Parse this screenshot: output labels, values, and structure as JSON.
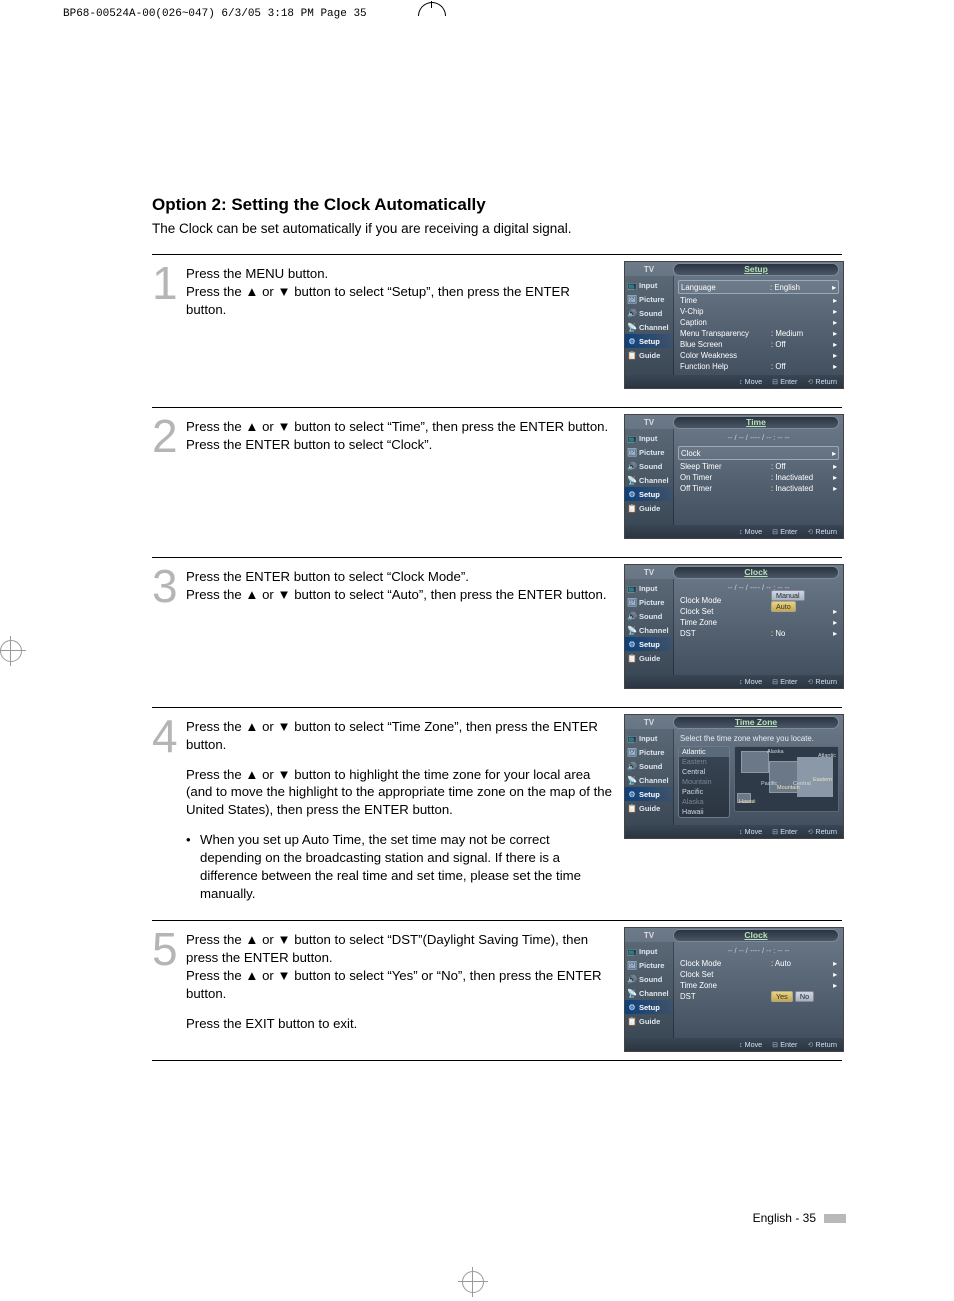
{
  "plate_line": "BP68-00524A-00(026~047)  6/3/05  3:18 PM  Page 35",
  "page_footer": {
    "text": "English - 35"
  },
  "heading": "Option 2: Setting the Clock Automatically",
  "intro": "The Clock can be set automatically if you are receiving a digital signal.",
  "arrows": {
    "up": "▲",
    "down": "▼"
  },
  "steps": {
    "s1": {
      "num": "1",
      "l1": "Press the MENU button.",
      "l2a": "Press the ",
      "l2b": " or ",
      "l2c": " button to select “Setup”, then press the ENTER button."
    },
    "s2": {
      "num": "2",
      "l1a": "Press the ",
      "l1b": " or ",
      "l1c": " button to select “Time”, then press the ENTER button.",
      "l2": "Press the ENTER button to select “Clock”."
    },
    "s3": {
      "num": "3",
      "l1": "Press the ENTER button to select “Clock Mode”.",
      "l2a": "Press the ",
      "l2b": " or ",
      "l2c": " button to select “Auto”, then press the ENTER button."
    },
    "s4": {
      "num": "4",
      "l1a": "Press the ",
      "l1b": " or ",
      "l1c": " button to select “Time Zone”, then press the ENTER button.",
      "l2a": "Press the ",
      "l2b": " or ",
      "l2c": " button to highlight the time zone for your local area (and to move the highlight to the appropriate time zone on the map of the United States), then press the ENTER button.",
      "bullet": "When you set up Auto Time, the set time may not be correct depending on the broadcasting station and signal. If there is a difference between the real time and set time, please set the time manually."
    },
    "s5": {
      "num": "5",
      "l1a": "Press the ",
      "l1b": " or ",
      "l1c": " button to select “DST”(Daylight Saving Time), then press the ENTER button.",
      "l2a": "Press the ",
      "l2b": " or ",
      "l2c": " button to select “Yes” or “No”, then press the ENTER button.",
      "l3": "Press the EXIT button to exit."
    }
  },
  "osd_common": {
    "tv": "TV",
    "side": [
      "Input",
      "Picture",
      "Sound",
      "Channel",
      "Setup",
      "Guide"
    ],
    "foot": {
      "move": "Move",
      "enter": "Enter",
      "return": "Return"
    },
    "date_placeholder": "-- / -- / ---- / --  :  --  --"
  },
  "osd1": {
    "title": "Setup",
    "rows": [
      {
        "k": "Language",
        "v": ": English",
        "sel": true
      },
      {
        "k": "Time",
        "v": ""
      },
      {
        "k": "V-Chip",
        "v": ""
      },
      {
        "k": "Caption",
        "v": ""
      },
      {
        "k": "Menu Transparency",
        "v": ": Medium"
      },
      {
        "k": "Blue Screen",
        "v": ": Off"
      },
      {
        "k": "Color Weakness",
        "v": ""
      },
      {
        "k": "Function Help",
        "v": ": Off"
      }
    ],
    "sel_side": 4
  },
  "osd2": {
    "title": "Time",
    "rows": [
      {
        "k": "Clock",
        "v": "",
        "sel": true
      },
      {
        "k": "Sleep Timer",
        "v": ": Off"
      },
      {
        "k": "On Timer",
        "v": ": Inactivated"
      },
      {
        "k": "Off Timer",
        "v": ": Inactivated"
      }
    ],
    "sel_side": 4
  },
  "osd3": {
    "title": "Clock",
    "rows": [
      {
        "k": "Clock Mode",
        "opts": [
          "Manual",
          "Auto"
        ],
        "sel_opt": 1
      },
      {
        "k": "Clock Set",
        "v": ""
      },
      {
        "k": "Time Zone",
        "v": ""
      },
      {
        "k": "DST",
        "v": ": No"
      }
    ],
    "sel_side": 4
  },
  "osd4": {
    "title": "Time Zone",
    "prompt": "Select the time zone where you locate.",
    "zones": [
      "Atlantic",
      "Eastern",
      "Central",
      "Mountain",
      "Pacific",
      "Alaska",
      "Hawaii"
    ],
    "map_labels": [
      "Alaska",
      "Atlantic",
      "Pacific",
      "Mountain",
      "Central",
      "Eastern",
      "Hawaii"
    ],
    "sel_side": 4
  },
  "osd5": {
    "title": "Clock",
    "rows": [
      {
        "k": "Clock Mode",
        "v": ": Auto"
      },
      {
        "k": "Clock Set",
        "v": ""
      },
      {
        "k": "Time Zone",
        "v": ""
      },
      {
        "k": "DST",
        "opts": [
          "Yes",
          "No"
        ],
        "sel_opt": 0
      }
    ],
    "sel_side": 4
  }
}
